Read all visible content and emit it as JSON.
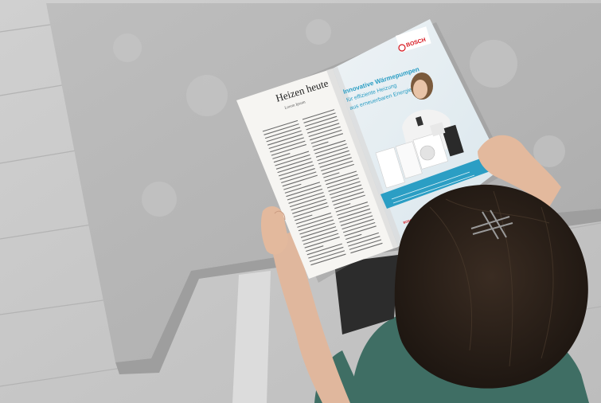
{
  "magazine": {
    "left_page": {
      "title": "Heizen heute",
      "subtitle": "Lorem Ipsum"
    },
    "ad": {
      "brand": "BOSCH",
      "headline": "Innovative Wärmepumpen",
      "subline_1": "für effiziente Heizung",
      "subline_2": "aus erneuerbaren Energien",
      "accent_color": "#2b9ec4",
      "brand_color": "#d7171f"
    }
  },
  "colors": {
    "wall": "#c9c9c9",
    "table": "#b9b9b9",
    "hair": "#2a2018",
    "sweater": "#3f6e64"
  }
}
